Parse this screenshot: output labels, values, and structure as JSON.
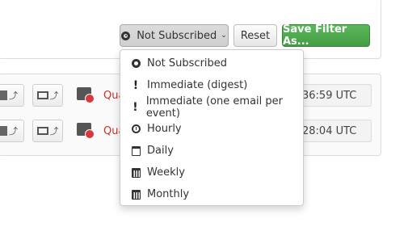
{
  "toolbar": {
    "subscription_label": "Not Subscribed",
    "reset_label": "Reset",
    "save_filter_label": "Save Filter As..."
  },
  "rows": [
    {
      "status_text": "Qua",
      "time_text": "36:59 UTC"
    },
    {
      "status_text": "Qua",
      "time_text": "28:04 UTC"
    }
  ],
  "dropdown": {
    "options": [
      {
        "label": "Not Subscribed",
        "icon": "circle-icon"
      },
      {
        "label": "Immediate (digest)",
        "icon": "exclamation-icon"
      },
      {
        "label": "Immediate (one email per event)",
        "icon": "exclamation-icon"
      },
      {
        "label": "Hourly",
        "icon": "clock-icon"
      },
      {
        "label": "Daily",
        "icon": "calendar-icon"
      },
      {
        "label": "Weekly",
        "icon": "calendar-grid-icon"
      },
      {
        "label": "Monthly",
        "icon": "calendar-grid-icon"
      }
    ]
  },
  "colors": {
    "save_button": "#4cae4c",
    "status_red": "#c9302c"
  }
}
